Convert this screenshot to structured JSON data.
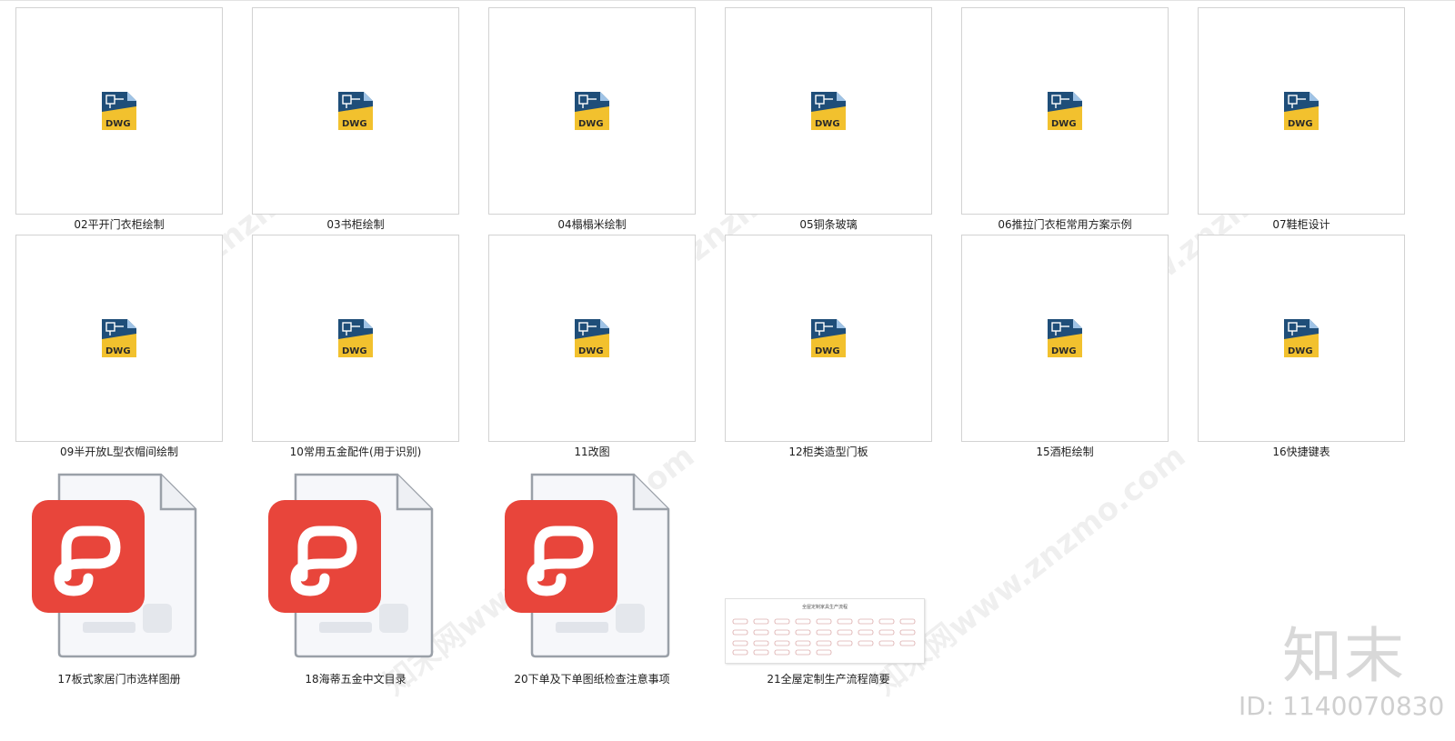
{
  "files": [
    {
      "name": "02平开门衣柜绘制",
      "type": "dwg"
    },
    {
      "name": "03书柜绘制",
      "type": "dwg"
    },
    {
      "name": "04榻榻米绘制",
      "type": "dwg"
    },
    {
      "name": "05铜条玻璃",
      "type": "dwg"
    },
    {
      "name": "06推拉门衣柜常用方案示例",
      "type": "dwg"
    },
    {
      "name": "07鞋柜设计",
      "type": "dwg"
    },
    {
      "name": "09半开放L型衣帽间绘制",
      "type": "dwg"
    },
    {
      "name": "10常用五金配件(用于识别)",
      "type": "dwg"
    },
    {
      "name": "11改图",
      "type": "dwg"
    },
    {
      "name": "12柜类造型门板",
      "type": "dwg"
    },
    {
      "name": "15酒柜绘制",
      "type": "dwg"
    },
    {
      "name": "16快捷键表",
      "type": "dwg"
    },
    {
      "name": "17板式家居门市选样图册",
      "type": "pdf"
    },
    {
      "name": "18海蒂五金中文目录",
      "type": "pdf"
    },
    {
      "name": "20下单及下单图纸检查注意事项",
      "type": "pdf"
    },
    {
      "name": "21全屋定制生产流程简要",
      "type": "doc-thumb"
    }
  ],
  "icons": {
    "dwg": "dwg-file-icon",
    "pdf": "wps-pdf-icon",
    "thumb": "document-thumbnail"
  },
  "dwg_badge_text": "DWG",
  "thumb_title": "全屋定制家具生产流程",
  "watermark": {
    "text": "知末网www.znzmo.com",
    "brand": "知末",
    "id": "ID: 1140070830"
  },
  "colors": {
    "pdf_red": "#e8453b",
    "dwg_blue": "#1f4e79",
    "dwg_yellow": "#f2c12e",
    "frame": "#d2d2d2"
  }
}
